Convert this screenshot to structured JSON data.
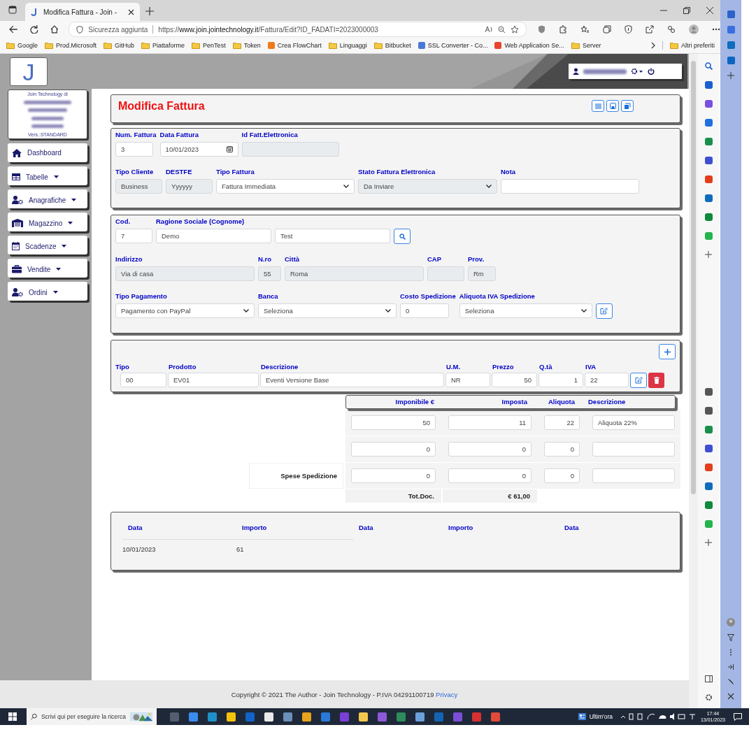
{
  "browser": {
    "tab_title": "Modifica Fattura - Join -",
    "security_label": "Sicurezza aggiunta",
    "url": {
      "scheme": "https://",
      "host": "www.join.jointechnology.it",
      "path": "/Fattura/Edit?ID_FADATI=2023000003"
    },
    "bookmarks": [
      {
        "label": "Google",
        "kind": "folder"
      },
      {
        "label": "Prod.Microsoft",
        "kind": "folder"
      },
      {
        "label": "GitHub",
        "kind": "folder"
      },
      {
        "label": "Piattaforme",
        "kind": "folder"
      },
      {
        "label": "PenTest",
        "kind": "folder"
      },
      {
        "label": "Token",
        "kind": "folder"
      },
      {
        "label": "Crea FlowChart",
        "kind": "site",
        "color": "#f07a1a"
      },
      {
        "label": "Linguaggi",
        "kind": "folder"
      },
      {
        "label": "Bitbucket",
        "kind": "folder"
      },
      {
        "label": "SSL Converter - Co...",
        "kind": "site",
        "color": "#4a78d8"
      },
      {
        "label": "Web Application Se...",
        "kind": "site",
        "color": "#e8452c"
      },
      {
        "label": "Server",
        "kind": "folder"
      }
    ],
    "more_bookmarks": "Altri preferiti"
  },
  "sidebar": {
    "logo": "J",
    "company": "Join Technology di",
    "version": "Vers.:STANDARD",
    "items": [
      {
        "label": "Dashboard",
        "kind": "home",
        "dropdown": false
      },
      {
        "label": "Tabelle",
        "kind": "table",
        "dropdown": true
      },
      {
        "label": "Anagrafiche",
        "kind": "users",
        "dropdown": true
      },
      {
        "label": "Magazzino",
        "kind": "warehouse",
        "dropdown": true
      },
      {
        "label": "Scadenze",
        "kind": "calendar",
        "dropdown": true
      },
      {
        "label": "Vendite",
        "kind": "briefcase",
        "dropdown": true
      },
      {
        "label": "Ordini",
        "kind": "users",
        "dropdown": true
      }
    ]
  },
  "invoice": {
    "title": "Modifica Fattura",
    "sections": [
      {
        "rows": [
          {
            "kind": "plain",
            "fields": [
              {
                "label": "Num. Fattura",
                "value": "3",
                "kind": "input",
                "disabled": false
              },
              {
                "label": "Data Fattura",
                "value": "10/01/2023",
                "kind": "date",
                "disabled": false
              },
              {
                "label": "Id Fatt.Elettronica",
                "kind": "input",
                "disabled": true
              }
            ]
          },
          {
            "kind": "plain",
            "fields": [
              {
                "label": "Tipo Cliente",
                "value": "Business",
                "kind": "input",
                "disabled": true
              },
              {
                "label": "DESTFE",
                "value": "Yyyyyy",
                "kind": "input",
                "disabled": true
              },
              {
                "label": "Tipo Fattura",
                "value": "Fattura Immediata",
                "kind": "select",
                "disabled": false
              },
              {
                "label": "Stato Fattura Elettronica",
                "value": "Da Inviare",
                "kind": "select",
                "disabled": true
              },
              {
                "label": "Nota",
                "kind": "input",
                "disabled": false
              }
            ]
          }
        ]
      },
      {
        "rows": [
          {
            "kind": "search",
            "fields": [
              {
                "label": "Cod.",
                "value": "7",
                "kind": "input",
                "disabled": false
              },
              {
                "label": "Ragione Sociale (Cognome)",
                "value": "Demo",
                "kind": "input",
                "disabled": false
              },
              {
                "value": "Test",
                "kind": "input",
                "disabled": false
              }
            ]
          },
          {
            "kind": "plain",
            "fields": [
              {
                "label": "Indirizzo",
                "value": "Via di casa",
                "kind": "input",
                "disabled": true
              },
              {
                "label": "N.ro",
                "value": "55",
                "kind": "input",
                "disabled": true
              },
              {
                "label": "Città",
                "value": "Roma",
                "kind": "input",
                "disabled": true
              },
              {
                "label": "CAP",
                "kind": "input",
                "disabled": true
              },
              {
                "label": "Prov.",
                "value": "Rm",
                "kind": "input",
                "disabled": true
              }
            ]
          },
          {
            "kind": "edit",
            "fields": [
              {
                "label": "Tipo Pagamento",
                "value": "Pagamento con PayPal",
                "kind": "select",
                "disabled": false
              },
              {
                "label": "Banca",
                "value": "Seleziona",
                "kind": "select",
                "disabled": false
              },
              {
                "label": "Costo Spedizione",
                "value": "0",
                "kind": "input",
                "disabled": false
              },
              {
                "label": "Aliquota IVA Spedizione",
                "value": "Seleziona",
                "kind": "select",
                "disabled": false
              }
            ]
          }
        ]
      }
    ],
    "items": {
      "columns": [
        "Tipo",
        "Prodotto",
        "Descrizione",
        "U.M.",
        "Prezzo",
        "Q.tà",
        "IVA"
      ],
      "rows": [
        {
          "cells": [
            "00",
            "EV01",
            "Eventi Versione Base",
            "NR",
            "50",
            "1",
            "22"
          ]
        }
      ]
    },
    "totals": {
      "columns": [
        "Imponibile €",
        "Imposta",
        "Aliquota",
        "Descrizione"
      ],
      "rows": [
        {
          "imponibile": "50",
          "imposta": "11",
          "aliquota": "22",
          "descrizione": "Aliquota 22%"
        },
        {
          "imponibile": "0",
          "imposta": "0",
          "aliquota": "0"
        },
        {
          "label": "Spese Spedizione",
          "imponibile": "0",
          "imposta": "0",
          "aliquota": "0"
        }
      ],
      "total_label": "Tot.Doc.",
      "total_value": "€ 61,00"
    },
    "payments": {
      "columns": [
        "Data",
        "Importo",
        "Data",
        "Importo",
        "Data"
      ],
      "rows": [
        [
          "10/01/2023",
          "61"
        ]
      ]
    }
  },
  "footer": {
    "text": "Copyright © 2021 The Author - Join Technology - P.IVA 04291100719",
    "link": "Privacy"
  },
  "taskbar": {
    "search_placeholder": "Scrivi qui per eseguire la ricerca",
    "news": "Ultim'ora",
    "time": "17:44",
    "date": "13/01/2023"
  }
}
